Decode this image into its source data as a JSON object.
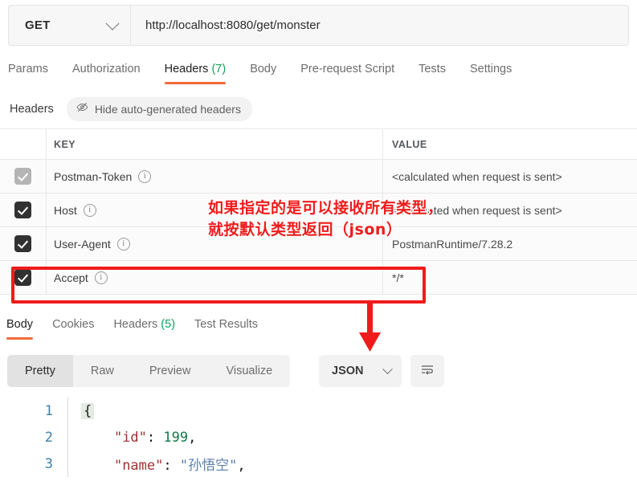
{
  "request": {
    "method": "GET",
    "method_icon": "chevron-down-icon",
    "url": "http://localhost:8080/get/monster",
    "tabs": [
      {
        "label": "Params",
        "active": false
      },
      {
        "label": "Authorization",
        "active": false
      },
      {
        "label": "Headers",
        "count": "(7)",
        "active": true
      },
      {
        "label": "Body",
        "active": false
      },
      {
        "label": "Pre-request Script",
        "active": false
      },
      {
        "label": "Tests",
        "active": false
      },
      {
        "label": "Settings",
        "active": false
      }
    ]
  },
  "headers_panel": {
    "title": "Headers",
    "hide_button_label": "Hide auto-generated headers",
    "hide_button_icon": "eye-off-icon",
    "columns": {
      "key": "KEY",
      "value": "VALUE"
    },
    "rows": [
      {
        "checked": true,
        "disabled": true,
        "key": "Postman-Token",
        "info_icon": "info-icon",
        "value": "<calculated when request is sent>"
      },
      {
        "checked": true,
        "disabled": false,
        "key": "Host",
        "info_icon": "info-icon",
        "value": "<calculated when request is sent>"
      },
      {
        "checked": true,
        "disabled": false,
        "key": "User-Agent",
        "info_icon": "info-icon",
        "value": "PostmanRuntime/7.28.2"
      },
      {
        "checked": true,
        "disabled": false,
        "key": "Accept",
        "info_icon": "info-icon",
        "value": "*/*"
      }
    ]
  },
  "response": {
    "tabs": [
      {
        "label": "Body",
        "active": true
      },
      {
        "label": "Cookies",
        "active": false
      },
      {
        "label": "Headers",
        "count": "(5)",
        "active": false
      },
      {
        "label": "Test Results",
        "active": false
      }
    ],
    "view_modes": [
      {
        "label": "Pretty",
        "active": true
      },
      {
        "label": "Raw",
        "active": false
      },
      {
        "label": "Preview",
        "active": false
      },
      {
        "label": "Visualize",
        "active": false
      }
    ],
    "format_select": {
      "value": "JSON",
      "icon": "chevron-down-icon"
    },
    "wrap_button_icon": "text-wrap-icon",
    "code_lines": [
      {
        "number": "1",
        "brace": "{",
        "key": "",
        "colon": "",
        "num": "",
        "str": "",
        "comma": ""
      },
      {
        "number": "2",
        "brace": "",
        "key": "\"id\"",
        "colon": ":",
        "num": " 199",
        "str": "",
        "comma": ","
      },
      {
        "number": "3",
        "brace": "",
        "key": "\"name\"",
        "colon": ":",
        "num": "",
        "str": " \"孙悟空\"",
        "comma": ","
      }
    ]
  },
  "annotations": {
    "note_text": "如果指定的是可以接收所有类型，\n就按默认类型返回（json）",
    "note_color": "#ef1b1b",
    "highlight_color": "#ef1b1b",
    "arrow_icon": "down-arrow-icon"
  },
  "colors": {
    "accent_orange": "#f26b3a",
    "count_green": "#13a05c",
    "annotation_red": "#ef1b1b"
  }
}
